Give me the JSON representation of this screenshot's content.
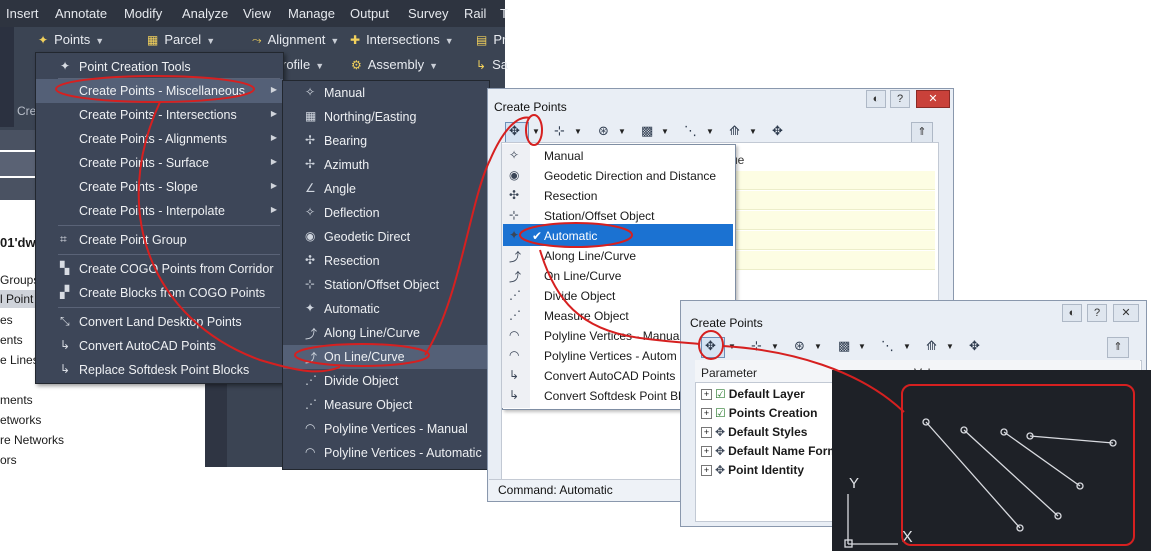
{
  "menubar": {
    "items": [
      "Insert",
      "Annotate",
      "Modify",
      "Analyze",
      "View",
      "Manage",
      "Output",
      "Survey",
      "Rail",
      "T"
    ]
  },
  "ribbon": {
    "points": "Points",
    "parcel": "Parcel",
    "alignment": "Alignment",
    "intersections": "Intersections",
    "pr": "Pr",
    "profile": "rofile",
    "assembly": "Assembly",
    "sa": "Sa",
    "cre": "Cre"
  },
  "prospector": {
    "drawing": "01'dw",
    "items": [
      "Groups",
      "l Point",
      "es",
      "ents",
      "e Lines",
      "ments",
      "etworks",
      "re Networks",
      "ors"
    ]
  },
  "points_menu": {
    "items": [
      {
        "label": "Point Creation Tools",
        "icon": "point-creation-tools-icon",
        "submenu": false
      },
      {
        "label": "Create Points - Miscellaneous",
        "icon": "",
        "submenu": true
      },
      {
        "label": "Create Points - Intersections",
        "icon": "",
        "submenu": true
      },
      {
        "label": "Create Points - Alignments",
        "icon": "",
        "submenu": true
      },
      {
        "label": "Create Points - Surface",
        "icon": "",
        "submenu": true
      },
      {
        "label": "Create Points - Slope",
        "icon": "",
        "submenu": true
      },
      {
        "label": "Create Points - Interpolate",
        "icon": "",
        "submenu": true
      },
      {
        "label": "Create Point Group",
        "icon": "point-group-icon",
        "submenu": false
      },
      {
        "label": "Create COGO Points from Corridor",
        "icon": "corridor-icon",
        "submenu": false
      },
      {
        "label": "Create Blocks from COGO Points",
        "icon": "blocks-icon",
        "submenu": false
      },
      {
        "label": "Convert Land Desktop Points",
        "icon": "convert-icon",
        "submenu": false
      },
      {
        "label": "Convert AutoCAD Points",
        "icon": "convert-icon",
        "submenu": false
      },
      {
        "label": "Replace Softdesk Point Blocks",
        "icon": "replace-icon",
        "submenu": false
      }
    ]
  },
  "sub_menu": {
    "items": [
      "Manual",
      "Northing/Easting",
      "Bearing",
      "Azimuth",
      "Angle",
      "Deflection",
      "Geodetic Direct",
      "Resection",
      "Station/Offset Object",
      "Automatic",
      "Along Line/Curve",
      "On Line/Curve",
      "Divide Object",
      "Measure Object",
      "Polyline Vertices - Manual",
      "Polyline Vertices - Automatic"
    ]
  },
  "window1": {
    "title": "Create Points",
    "value_header": "ue",
    "status": "Command: Automatic",
    "dropdown": [
      "Manual",
      "Geodetic Direction and Distance",
      "Resection",
      "Station/Offset Object",
      "Automatic",
      "Along Line/Curve",
      "On Line/Curve",
      "Divide Object",
      "Measure Object",
      "Polyline Vertices - Manua",
      "Polyline Vertices - Autom",
      "Convert AutoCAD Points",
      "Convert Softdesk Point Bl"
    ],
    "selected_check": "✔"
  },
  "window2": {
    "title": "Create Points",
    "parameter_header": "Parameter",
    "value_header": "Valu",
    "rows": [
      "Default Layer",
      "Points Creation",
      "Default Styles",
      "Default Name Form",
      "Point Identity"
    ]
  },
  "preview": {
    "y_label": "Y",
    "x_label": "X"
  },
  "colors": {
    "highlight_red": "#d62020",
    "selected_blue": "#1b72d2",
    "ribbon_dark": "#3b4453"
  }
}
